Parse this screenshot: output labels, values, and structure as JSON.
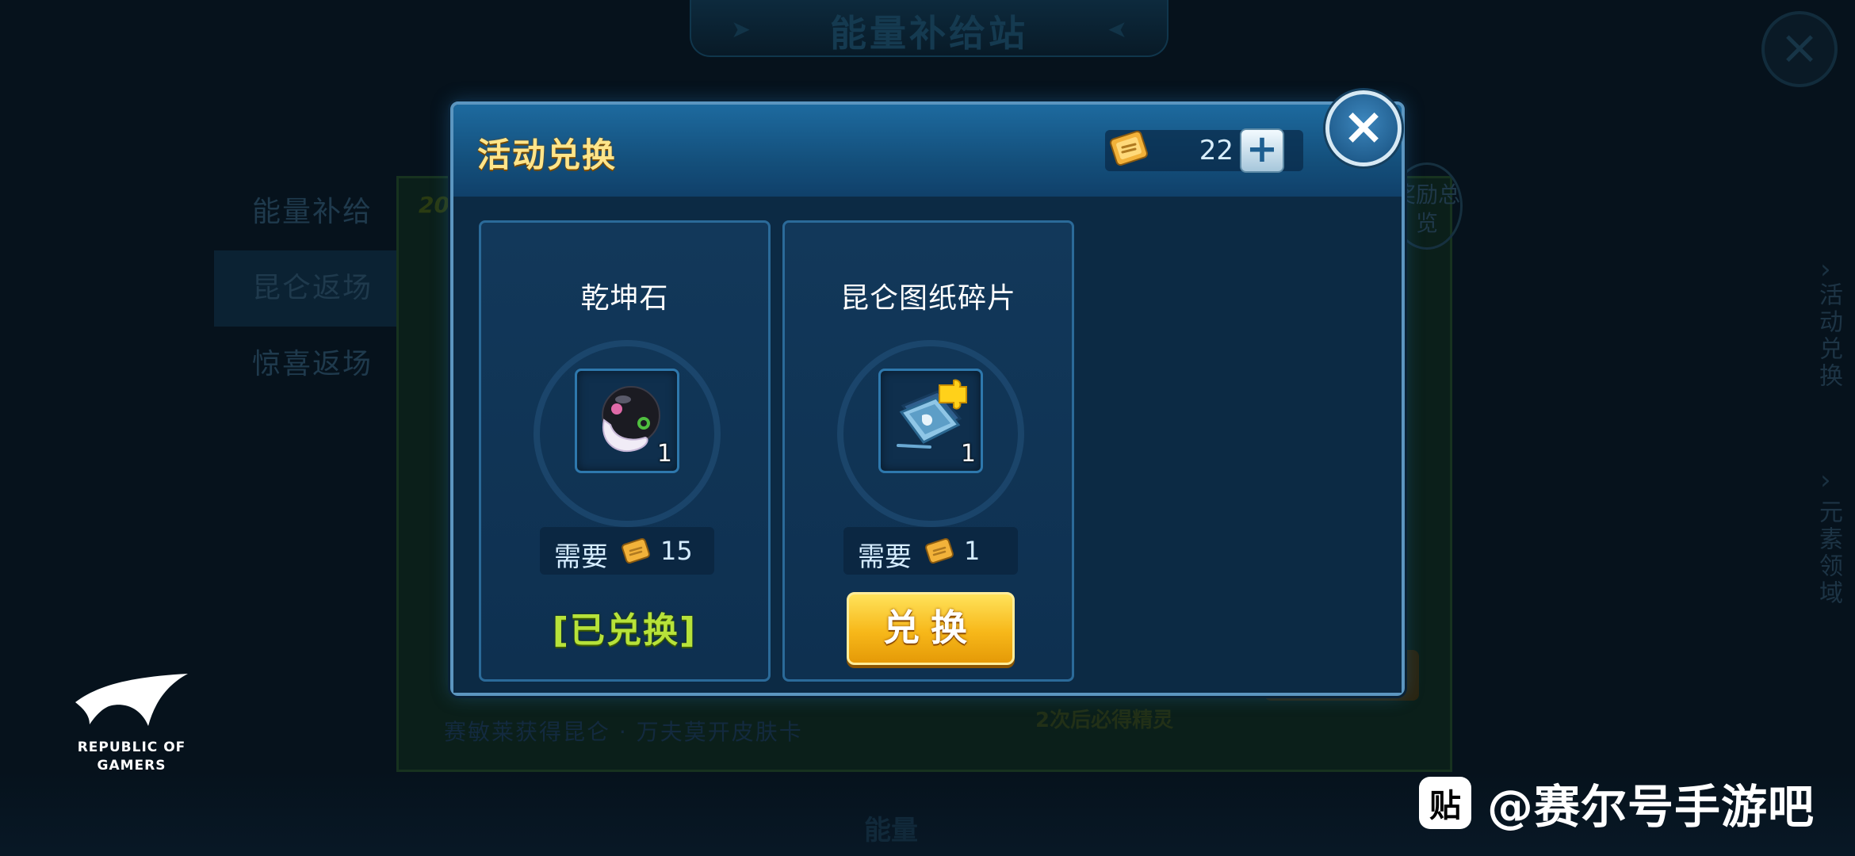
{
  "background": {
    "title": "能量补给站",
    "nav_items": [
      "能量补给",
      "昆仑返场",
      "惊喜返场"
    ],
    "year_text": "20",
    "caption": "赛敏莱获得昆仑 · 万夫莫开皮肤卡",
    "note": "2次后必得精灵",
    "reward_label": "奖励总览",
    "right_tabs": [
      "活动兑换",
      "元素领域"
    ],
    "bottom_text": "能量"
  },
  "rog_logo": {
    "line1": "REPUBLIC OF",
    "line2": "GAMERS"
  },
  "watermark": {
    "icon_char": "贴",
    "text": "@赛尔号手游吧"
  },
  "dialog": {
    "title": "活动兑换",
    "currency": {
      "icon": "ticket-icon",
      "value": "22"
    },
    "plus_label": "+",
    "close_label": "×",
    "items": [
      {
        "name": "乾坤石",
        "icon": "qiankun-stone-icon",
        "count": "1",
        "cost_label": "需要",
        "cost_icon": "ticket-icon",
        "cost_value": "15",
        "status": "[已兑换]"
      },
      {
        "name": "昆仑图纸碎片",
        "icon": "blueprint-fragment-icon",
        "count": "1",
        "cost_label": "需要",
        "cost_icon": "ticket-icon",
        "cost_value": "1",
        "button_label": "兑换"
      }
    ]
  },
  "colors": {
    "title_gold": "#ffe58a",
    "exchanged_green": "#b7e23a",
    "button_yellow": "#f7b81a",
    "panel_blue": "#0d2b45"
  }
}
